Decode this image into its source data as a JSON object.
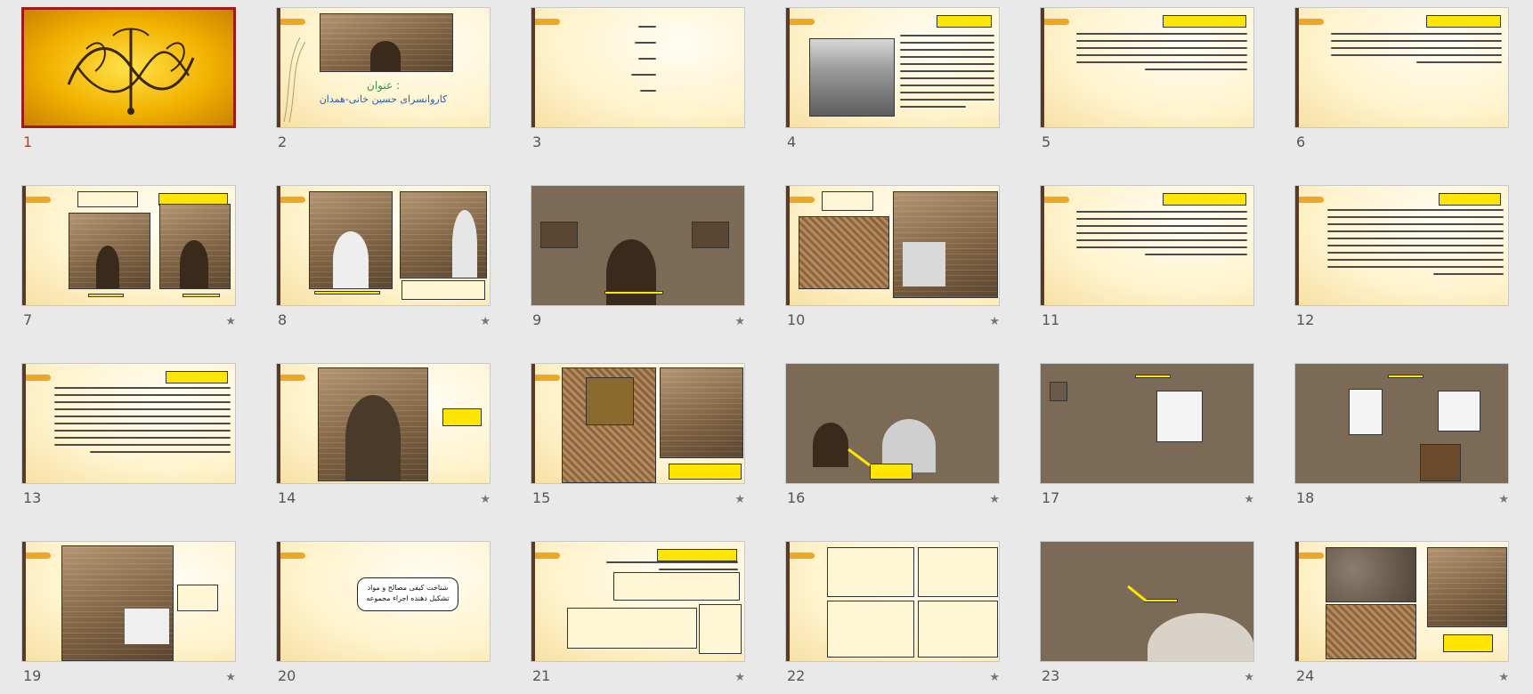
{
  "slides": [
    {
      "number": "1",
      "starred": false,
      "selected": true
    },
    {
      "number": "2",
      "starred": false,
      "title_label": "عنوان :",
      "subtitle": "کاروانسرای حسین خانی-همدان"
    },
    {
      "number": "3",
      "starred": false
    },
    {
      "number": "4",
      "starred": false
    },
    {
      "number": "5",
      "starred": false
    },
    {
      "number": "6",
      "starred": false
    },
    {
      "number": "7",
      "starred": true
    },
    {
      "number": "8",
      "starred": true
    },
    {
      "number": "9",
      "starred": true
    },
    {
      "number": "10",
      "starred": true
    },
    {
      "number": "11",
      "starred": false
    },
    {
      "number": "12",
      "starred": false
    },
    {
      "number": "13",
      "starred": false
    },
    {
      "number": "14",
      "starred": true
    },
    {
      "number": "15",
      "starred": true
    },
    {
      "number": "16",
      "starred": true
    },
    {
      "number": "17",
      "starred": true
    },
    {
      "number": "18",
      "starred": true
    },
    {
      "number": "19",
      "starred": true
    },
    {
      "number": "20",
      "starred": false,
      "box_line1": "شناخت کیفی مصالح و مواد",
      "box_line2": "تشکیل دهنده اجزاء مجموعه"
    },
    {
      "number": "21",
      "starred": true
    },
    {
      "number": "22",
      "starred": true
    },
    {
      "number": "23",
      "starred": true
    },
    {
      "number": "24",
      "starred": true
    }
  ],
  "star_glyph": "★",
  "colors": {
    "selected_border": "#9e1b1b",
    "accent_tab": "#f0a524",
    "highlight": "#ffe600",
    "title_green": "#2e9b4a",
    "title_blue": "#2b5fa8"
  }
}
